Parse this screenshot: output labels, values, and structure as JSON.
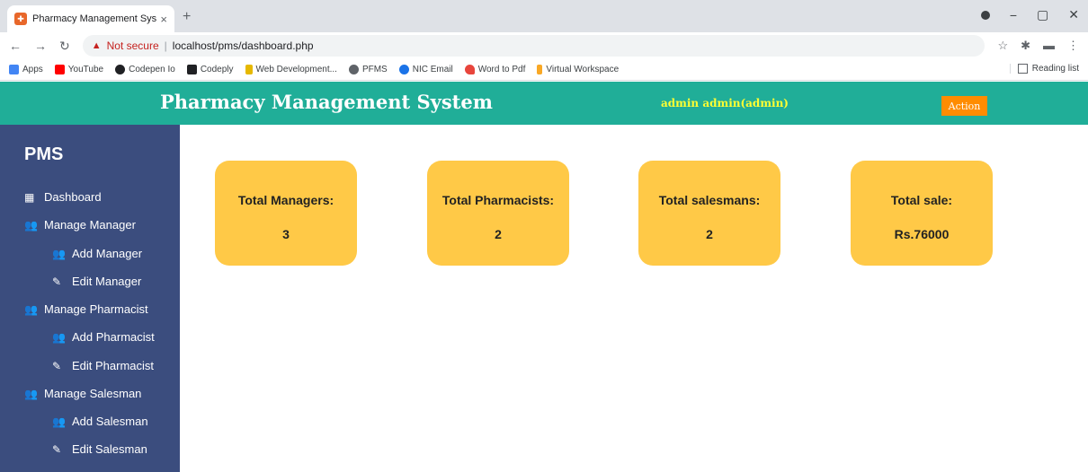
{
  "browser": {
    "tab_title": "Pharmacy Management System",
    "tab_close": "×",
    "new_tab": "+",
    "not_secure": "Not secure",
    "separator": "|",
    "url": "localhost/pms/dashboard.php",
    "bookmarks": [
      {
        "label": "Apps",
        "color": "#4285f4"
      },
      {
        "label": "YouTube",
        "color": "#ff0000"
      },
      {
        "label": "Codepen Io",
        "color": "#202124"
      },
      {
        "label": "Codeply",
        "color": "#202124"
      },
      {
        "label": "Web Development...",
        "color": "#e6b800"
      },
      {
        "label": "PFMS",
        "color": "#5f6368"
      },
      {
        "label": "NIC Email",
        "color": "#1a73e8"
      },
      {
        "label": "Word to Pdf",
        "color": "#e8453c"
      },
      {
        "label": "Virtual Workspace",
        "color": "#f9a825"
      }
    ],
    "reading_list": "Reading list"
  },
  "header": {
    "title": "Pharmacy Management System",
    "user": "admin admin(admin)",
    "action_label": "Action"
  },
  "sidebar": {
    "brand": "PMS",
    "items": [
      {
        "label": "Dashboard",
        "icon": "table-icon"
      },
      {
        "label": "Manage Manager",
        "icon": "user-plus-icon"
      },
      {
        "label": "Add Manager",
        "icon": "user-plus-icon"
      },
      {
        "label": "Edit Manager",
        "icon": "edit-icon"
      },
      {
        "label": "Manage Pharmacist",
        "icon": "user-plus-icon"
      },
      {
        "label": "Add Pharmacist",
        "icon": "user-plus-icon"
      },
      {
        "label": "Edit Pharmacist",
        "icon": "edit-icon"
      },
      {
        "label": "Manage Salesman",
        "icon": "user-plus-icon"
      },
      {
        "label": "Add Salesman",
        "icon": "user-plus-icon"
      },
      {
        "label": "Edit Salesman",
        "icon": "edit-icon"
      }
    ]
  },
  "cards": [
    {
      "label": "Total Managers:",
      "value": "3"
    },
    {
      "label": "Total Pharmacists:",
      "value": "2"
    },
    {
      "label": "Total salesmans:",
      "value": "2"
    },
    {
      "label": "Total sale:",
      "value": "Rs.76000"
    }
  ],
  "colors": {
    "header": "#20ae98",
    "sidebar": "#3b4d7e",
    "card": "#ffc947",
    "action": "#ff8c00",
    "user": "#ffff33"
  }
}
